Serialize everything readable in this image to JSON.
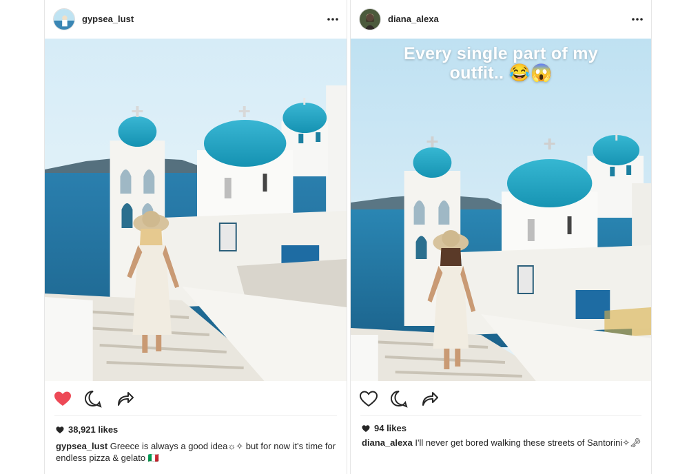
{
  "left_post": {
    "username": "gypsea_lust",
    "likes": "38,921 likes",
    "caption_user": "gypsea_lust",
    "caption_text": "Greece is always a good idea☼✧ but for now it's time for endless pizza & gelato 🇮🇹",
    "liked": true,
    "like_color": "#ed4956"
  },
  "right_post": {
    "username": "diana_alexa",
    "overlay_line1": "Every single part of my",
    "overlay_line2": "outfit.. 😂😱",
    "likes": "94 likes",
    "caption_user": "diana_alexa",
    "caption_text": "I'll never get bored walking these streets of Santorini✧🗝",
    "liked": false
  },
  "icons": {
    "more": "more-options-icon",
    "like": "heart-icon",
    "comment": "comment-icon",
    "share": "share-icon"
  },
  "colors": {
    "text": "#262626",
    "dome": "#1ea7c6",
    "sea": "#1f6f99"
  }
}
